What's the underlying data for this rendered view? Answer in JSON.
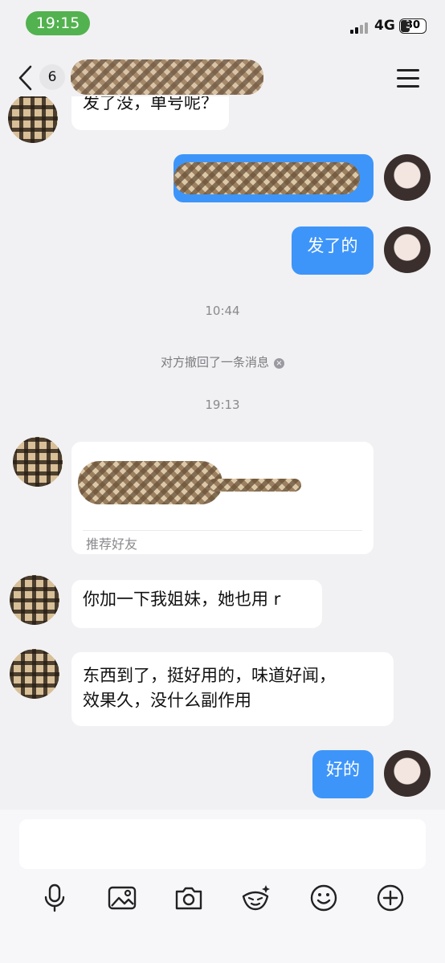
{
  "status_bar": {
    "time": "19:15",
    "network": "4G",
    "battery": "30"
  },
  "nav": {
    "unread_count": "6"
  },
  "messages": {
    "partial_top": "发了没，单号呢？",
    "sent_1": "发了的",
    "time_1": "10:44",
    "recall_notice": "对方撤回了一条消息",
    "recall_icon": "×",
    "time_2": "19:13",
    "card_label": "推荐好友",
    "recv_1": "你加一下我姐妹，她也用 r",
    "recv_2_line1": "东西到了，挺好用的，味道好闻，",
    "recv_2_line2": "效果久，没什么副作用",
    "sent_2": "好的"
  },
  "input": {
    "placeholder": ""
  },
  "toolbar_icons": [
    "microphone-icon",
    "image-icon",
    "camera-icon",
    "sticker-icon",
    "emoji-icon",
    "plus-icon"
  ],
  "colors": {
    "status_pill": "#52b24f",
    "sent_bubble": "#3e95f9",
    "background": "#f1f1f3"
  }
}
